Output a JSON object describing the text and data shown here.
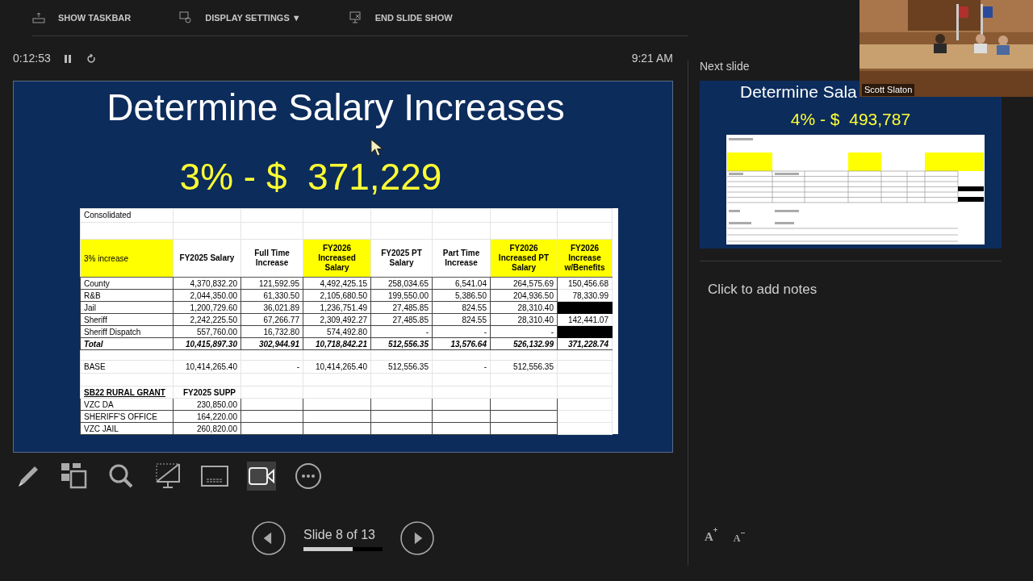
{
  "top_bar": {
    "items": [
      {
        "kind": "taskbar",
        "label": "SHOW TASKBAR"
      },
      {
        "kind": "display",
        "label": "DISPLAY SETTINGS ▼"
      },
      {
        "kind": "end",
        "label": "END SLIDE SHOW"
      }
    ]
  },
  "timer": {
    "elapsed": "0:12:53",
    "clock": "9:21 AM"
  },
  "slide": {
    "title": "Determine Salary Increases",
    "subtitle": "3% - $  371,229",
    "table": {
      "caption": "Consolidated",
      "columns": [
        {
          "label": "3% increase",
          "highlighted": true
        },
        {
          "label": "FY2025 Salary",
          "highlighted": false
        },
        {
          "label": "Full Time Increase",
          "highlighted": false
        },
        {
          "label": "FY2026 Increased Salary",
          "highlighted": true
        },
        {
          "label": "FY2025 PT Salary",
          "highlighted": false
        },
        {
          "label": "Part Time Increase",
          "highlighted": false
        },
        {
          "label": "FY2026 Increased PT Salary",
          "highlighted": true
        },
        {
          "label": "FY2026 Increase w/Benefits",
          "highlighted": true
        }
      ],
      "rows": [
        {
          "kind": "data",
          "blacked_out": false,
          "cells": [
            "County",
            "4,370,832.20",
            "121,592.95",
            "4,492,425.15",
            "258,034.65",
            "6,541.04",
            "264,575.69",
            "150,456.68"
          ]
        },
        {
          "kind": "data",
          "blacked_out": false,
          "cells": [
            "R&B",
            "2,044,350.00",
            "61,330.50",
            "2,105,680.50",
            "199,550.00",
            "5,386.50",
            "204,936.50",
            "78,330.99"
          ]
        },
        {
          "kind": "data",
          "blacked_out": true,
          "cells": [
            "Jail",
            "1,200,729.60",
            "36,021.89",
            "1,236,751.49",
            "27,485.85",
            "824.55",
            "28,310.40"
          ]
        },
        {
          "kind": "data",
          "blacked_out": false,
          "cells": [
            "Sheriff",
            "2,242,225.50",
            "67,266.77",
            "2,309,492.27",
            "27,485.85",
            "824.55",
            "28,310.40",
            "142,441.07"
          ]
        },
        {
          "kind": "data",
          "blacked_out": true,
          "cells": [
            "Sheriff Dispatch",
            "557,760.00",
            "16,732.80",
            "574,492.80",
            "-",
            "-",
            "-"
          ]
        },
        {
          "kind": "total",
          "blacked_out": false,
          "cells": [
            "Total",
            "10,415,897.30",
            "302,944.91",
            "10,718,842.21",
            "512,556.35",
            "13,576.64",
            "526,132.99",
            "371,228.74"
          ]
        },
        {
          "kind": "base",
          "blacked_out": false,
          "cells": [
            "BASE",
            "10,414,265.40",
            "-",
            "10,414,265.40",
            "512,556.35",
            "-",
            "512,556.35"
          ]
        },
        {
          "kind": "section",
          "blacked_out": false,
          "cells": [
            "SB22 RURAL GRANT",
            "FY2025 SUPP"
          ]
        },
        {
          "kind": "grant",
          "blacked_out": false,
          "cells": [
            "VZC DA",
            "230,850.00"
          ]
        },
        {
          "kind": "grant",
          "blacked_out": false,
          "cells": [
            "SHERIFF'S OFFICE",
            "164,220.00"
          ]
        },
        {
          "kind": "grant",
          "blacked_out": false,
          "cells": [
            "VZC JAIL",
            "260,820.00"
          ]
        }
      ]
    }
  },
  "toolbar": [
    {
      "kind": "pen",
      "selected": false
    },
    {
      "kind": "slides",
      "selected": false
    },
    {
      "kind": "zoom",
      "selected": false
    },
    {
      "kind": "blackscreen",
      "selected": false
    },
    {
      "kind": "subtitles",
      "selected": false
    },
    {
      "kind": "camera",
      "selected": true
    },
    {
      "kind": "more",
      "selected": false
    }
  ],
  "navigation": {
    "counter": "Slide 8 of 13",
    "level": 0.62
  },
  "next_slide": {
    "label": "Next slide",
    "title": "Determine Sala",
    "subtitle": "4% - $  493,787"
  },
  "notes": {
    "placeholder": "Click to add notes"
  },
  "font_buttons": [
    {
      "kind": "increase",
      "label": "A"
    },
    {
      "kind": "decrease",
      "label": "A"
    }
  ],
  "video": {
    "kind": "picture",
    "name": "Scott Slaton"
  }
}
